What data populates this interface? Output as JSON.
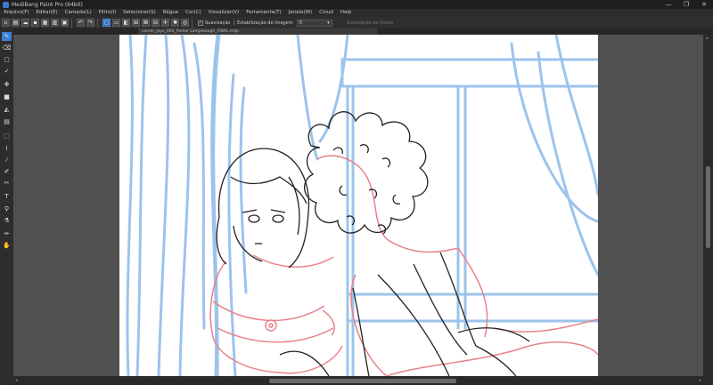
{
  "window": {
    "title": "MediBang Paint Pro (64bit)",
    "min_glyph": "—",
    "max_glyph": "❐",
    "close_glyph": "✕"
  },
  "menu": [
    {
      "id": "arquivo",
      "label": "Arquivo(F)"
    },
    {
      "id": "editar",
      "label": "Editar(E)"
    },
    {
      "id": "camada",
      "label": "Camada(L)"
    },
    {
      "id": "filtro",
      "label": "Filtro(I)"
    },
    {
      "id": "selecionar",
      "label": "Selecionar(S)"
    },
    {
      "id": "regua",
      "label": "Régua"
    },
    {
      "id": "cor",
      "label": "Cor(C)"
    },
    {
      "id": "visualizar",
      "label": "Visualizar(V)"
    },
    {
      "id": "ferramenta",
      "label": "Ferramenta(T)"
    },
    {
      "id": "janela",
      "label": "Janela(W)"
    },
    {
      "id": "cloud",
      "label": "Cloud"
    },
    {
      "id": "help",
      "label": "Help"
    }
  ],
  "toolbar": {
    "suavizacao_check": "✓",
    "suavizacao_label": "Suavização",
    "estabilizacao_label": "Estabilização de imagem",
    "estabilizacao_value": "0",
    "combo_arrow": "▾",
    "correcao_label": "Suavização de linhas"
  },
  "document": {
    "tab_label": "comm_jaye_004_Parker Lamploaugh_FINAL.mdp"
  },
  "canvas": {
    "line_blue": "#9cc3ec",
    "line_red": "#e8828a",
    "line_black": "#222222"
  }
}
